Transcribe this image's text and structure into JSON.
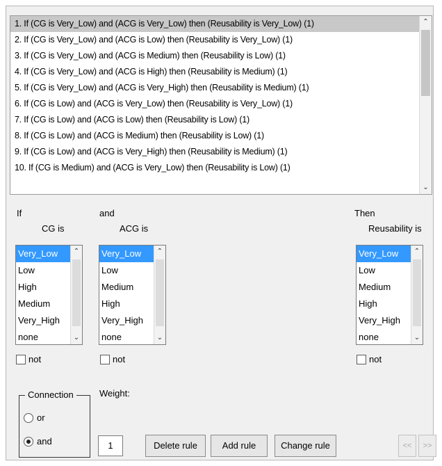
{
  "rules": [
    "1. If (CG is Very_Low) and (ACG is Very_Low) then (Reusability is Very_Low) (1)",
    "2. If (CG is Very_Low) and (ACG is Low) then (Reusability is Very_Low) (1)",
    "3. If (CG is Very_Low) and (ACG is Medium) then (Reusability is Low) (1)",
    "4. If (CG is Very_Low) and (ACG is High) then (Reusability is Medium) (1)",
    "5. If (CG is Very_Low) and (ACG is Very_High) then (Reusability is Medium) (1)",
    "6. If (CG is Low) and (ACG is Very_Low) then (Reusability is Very_Low) (1)",
    "7. If (CG is Low) and (ACG is Low) then (Reusability is Low) (1)",
    "8. If (CG is Low) and (ACG is Medium) then (Reusability is Low) (1)",
    "9. If (CG is Low) and (ACG is Very_High) then (Reusability is Medium) (1)",
    "10. If (CG is Medium) and (ACG is Very_Low) then (Reusability is Low) (1)"
  ],
  "selected_rule_index": 0,
  "if_label": "If",
  "and_label": "and",
  "then_label": "Then",
  "cg": {
    "header": "CG is",
    "options": [
      "Very_Low",
      "Low",
      "High",
      "Medium",
      "Very_High",
      "none"
    ],
    "selected_index": 0,
    "not_label": "not",
    "not_checked": false
  },
  "acg": {
    "header": "ACG is",
    "options": [
      "Very_Low",
      "Low",
      "Medium",
      "High",
      "Very_High",
      "none"
    ],
    "selected_index": 0,
    "not_label": "not",
    "not_checked": false
  },
  "reusability": {
    "header": "Reusability is",
    "options": [
      "Very_Low",
      "Low",
      "Medium",
      "High",
      "Very_High",
      "none"
    ],
    "selected_index": 0,
    "not_label": "not",
    "not_checked": false
  },
  "connection": {
    "title": "Connection",
    "or_label": "or",
    "and_label": "and",
    "selected": "and"
  },
  "weight": {
    "label": "Weight:",
    "value": "1"
  },
  "buttons": {
    "delete_rule": "Delete rule",
    "add_rule": "Add rule",
    "change_rule": "Change rule",
    "prev": "<<",
    "next": ">>"
  },
  "colors": {
    "selection_blue": "#3399ff",
    "selected_rule_gray": "#c8c8c8",
    "panel_bg": "#f0f0f0"
  },
  "icons": {
    "scroll_up": "chevron-up-icon",
    "scroll_down": "chevron-down-icon"
  }
}
